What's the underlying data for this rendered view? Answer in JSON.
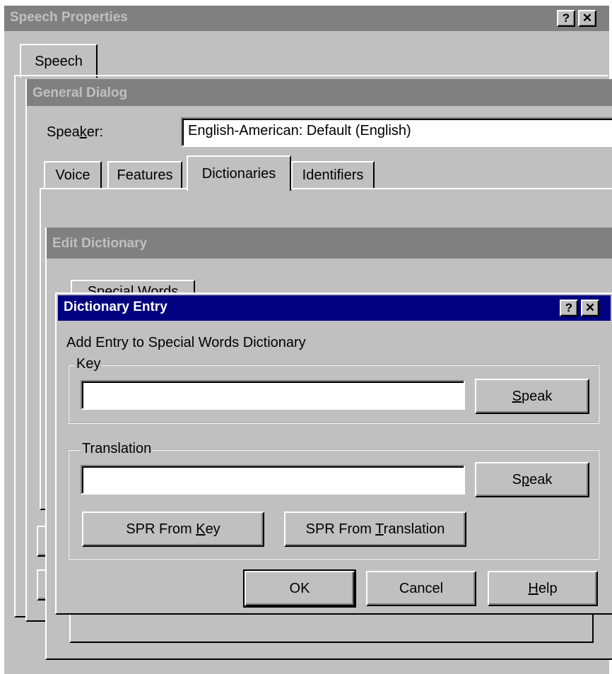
{
  "speech_properties": {
    "title": "Speech Properties",
    "help_glyph": "?",
    "close_glyph": "✕",
    "tab_speech": "Speech"
  },
  "general_dialog": {
    "title": "General Dialog",
    "speaker_label_pre": "Spea",
    "speaker_label_ul": "k",
    "speaker_label_post": "er:",
    "speaker_value": "English-American: Default (English)",
    "tabs": [
      "Voice",
      "Features",
      "Dictionaries",
      "Identifiers"
    ]
  },
  "edit_dictionary": {
    "title": "Edit Dictionary",
    "partial_tab": "Special Words"
  },
  "dictionary_entry": {
    "title": "Dictionary Entry",
    "help_glyph": "?",
    "close_glyph": "✕",
    "description": "Add Entry to Special Words Dictionary",
    "key_group_label": "Key",
    "key_value": "",
    "key_speak_ul": "S",
    "key_speak_rest": "peak",
    "translation_group_label": "Translation",
    "translation_value": "",
    "translation_speak_pre": "S",
    "translation_speak_ul": "p",
    "translation_speak_rest": "eak",
    "spr_key_pre": "SPR From ",
    "spr_key_ul": "K",
    "spr_key_rest": "ey",
    "spr_trans_pre": "SPR From ",
    "spr_trans_ul": "T",
    "spr_trans_rest": "ranslation",
    "ok_label": "OK",
    "cancel_label": "Cancel",
    "help_ul": "H",
    "help_rest": "elp"
  }
}
